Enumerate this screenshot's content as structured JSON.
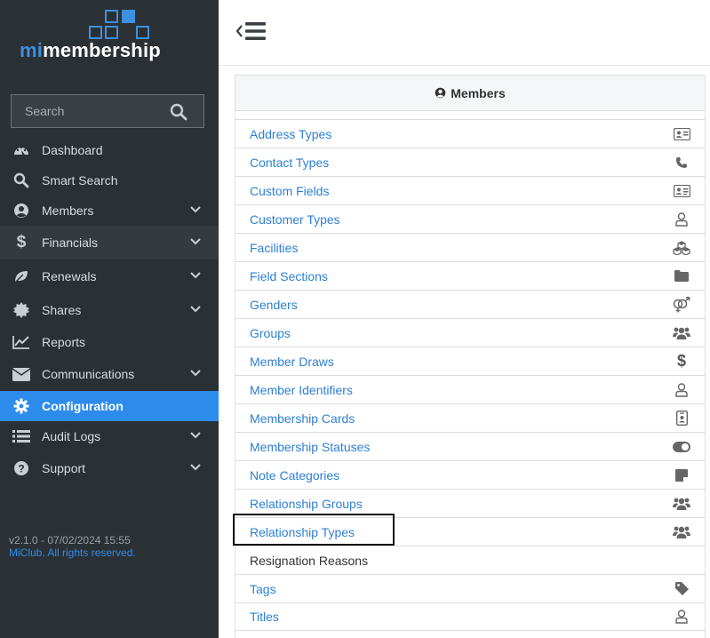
{
  "brand": {
    "prefix": "mi",
    "suffix": "membership"
  },
  "search": {
    "placeholder": "Search"
  },
  "nav": [
    {
      "label": "Dashboard",
      "icon": "dashboard-icon"
    },
    {
      "label": "Smart Search",
      "icon": "search-icon"
    },
    {
      "label": "Members",
      "icon": "user-circle-icon"
    },
    {
      "label": "Financials",
      "icon": "dollar-icon"
    },
    {
      "label": "Renewals",
      "icon": "leaf-icon"
    },
    {
      "label": "Shares",
      "icon": "certificate-icon"
    },
    {
      "label": "Reports",
      "icon": "line-chart-icon"
    },
    {
      "label": "Communications",
      "icon": "envelope-icon"
    },
    {
      "label": "Configuration",
      "icon": "gear-icon"
    },
    {
      "label": "Audit Logs",
      "icon": "list-icon"
    },
    {
      "label": "Support",
      "icon": "question-circle-icon"
    }
  ],
  "footer": {
    "version": "v2.1.0 - 07/02/2024 15:55",
    "copyright": "MiClub. All rights reserved."
  },
  "panel": {
    "title": "Members",
    "items": [
      {
        "label": "Address Types",
        "icon": "address-card-icon"
      },
      {
        "label": "Contact Types",
        "icon": "phone-icon"
      },
      {
        "label": "Custom Fields",
        "icon": "id-card-icon"
      },
      {
        "label": "Customer Types",
        "icon": "user-icon"
      },
      {
        "label": "Facilities",
        "icon": "cubes-icon"
      },
      {
        "label": "Field Sections",
        "icon": "folder-icon"
      },
      {
        "label": "Genders",
        "icon": "gender-icon"
      },
      {
        "label": "Groups",
        "icon": "users-icon"
      },
      {
        "label": "Member Draws",
        "icon": "dollar-icon"
      },
      {
        "label": "Member Identifiers",
        "icon": "user-icon"
      },
      {
        "label": "Membership Cards",
        "icon": "id-badge-icon"
      },
      {
        "label": "Membership Statuses",
        "icon": "toggle-icon"
      },
      {
        "label": "Note Categories",
        "icon": "sticky-note-icon"
      },
      {
        "label": "Relationship Groups",
        "icon": "users-icon"
      },
      {
        "label": "Relationship Types",
        "icon": "users-icon"
      },
      {
        "label": "Resignation Reasons",
        "icon": ""
      },
      {
        "label": "Tags",
        "icon": "tag-icon"
      },
      {
        "label": "Titles",
        "icon": "user-icon"
      }
    ]
  },
  "colors": {
    "sidebar": "#2b3035",
    "accent": "#2d8ceb",
    "link": "#2d7fd3"
  }
}
